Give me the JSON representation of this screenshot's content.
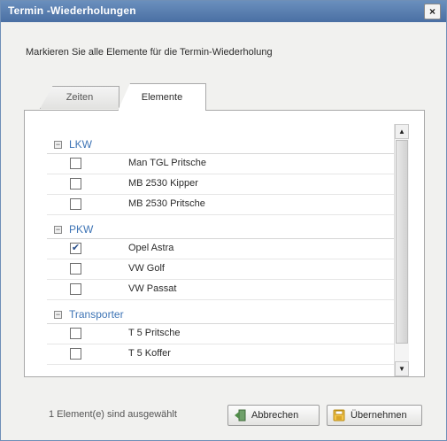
{
  "window": {
    "title": "Termin -Wiederholungen",
    "close_glyph": "×"
  },
  "instruction": "Markieren Sie alle Elemente für die Termin-Wiederholung",
  "tabs": [
    {
      "label": "Zeiten",
      "active": false
    },
    {
      "label": "Elemente",
      "active": true
    }
  ],
  "groups": [
    {
      "name": "LKW",
      "toggle": "−",
      "items": [
        {
          "label": "Man TGL Pritsche",
          "checked": false
        },
        {
          "label": "MB 2530 Kipper",
          "checked": false
        },
        {
          "label": "MB 2530 Pritsche",
          "checked": false
        }
      ]
    },
    {
      "name": "PKW",
      "toggle": "−",
      "items": [
        {
          "label": "Opel Astra",
          "checked": true
        },
        {
          "label": "VW Golf",
          "checked": false
        },
        {
          "label": "VW Passat",
          "checked": false
        }
      ]
    },
    {
      "name": "Transporter",
      "toggle": "−",
      "items": [
        {
          "label": "T 5 Pritsche",
          "checked": false
        },
        {
          "label": "T 5 Koffer",
          "checked": false
        }
      ]
    }
  ],
  "scrollbar": {
    "up": "▲",
    "down": "▼"
  },
  "status": "1 Element(e) sind ausgewählt",
  "buttons": {
    "cancel": "Abbrechen",
    "ok": "Übernehmen"
  },
  "colors": {
    "title_bar": "#4a6fa3",
    "group_label": "#3e74b5",
    "check_mark": "#2a4f8a"
  },
  "icons": {
    "close": "close-icon",
    "cancel": "cancel-icon",
    "ok": "accept-icon",
    "group_toggle": "collapse-icon",
    "checkbox_mark": "checkmark-icon"
  }
}
